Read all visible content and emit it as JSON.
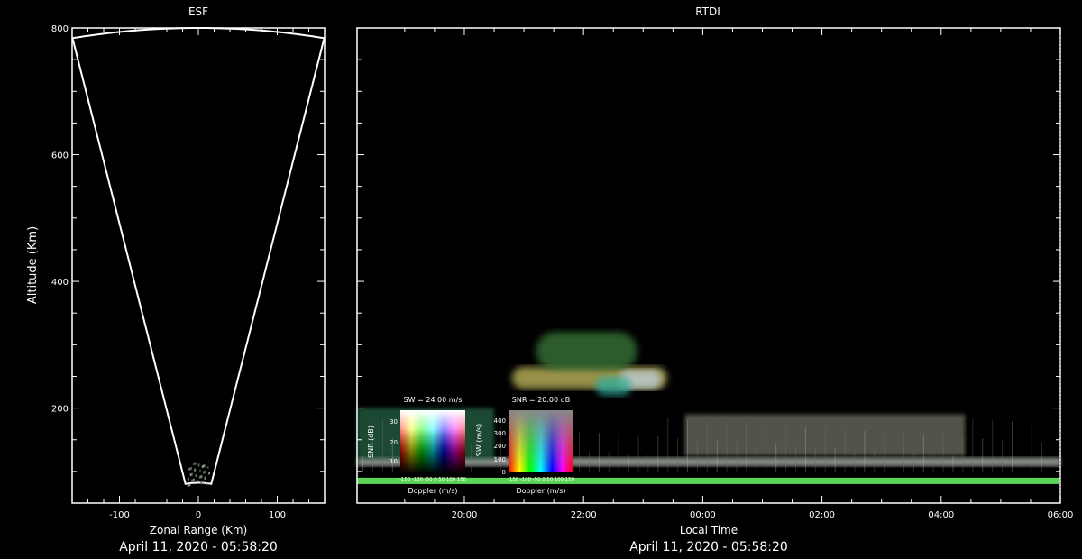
{
  "colors": {
    "background": "#000000",
    "foreground": "#ffffff",
    "echo_green": "#5fe05a"
  },
  "chart_data": [
    {
      "type": "other",
      "name": "esf-fan-plot",
      "title": "ESF",
      "xlabel": "Zonal Range (Km)",
      "ylabel": "Altitude (Km)",
      "xlim": [
        -160,
        160
      ],
      "ylim": [
        50,
        800
      ],
      "xticks": [
        -100,
        0,
        100
      ],
      "yticks": [
        200,
        400,
        600,
        800
      ],
      "minor_ytick_step": 50,
      "minor_xtick_step": 20,
      "beam_half_angle_deg": 11.5,
      "fan_min_range": 82,
      "fan_max_range": 800,
      "echo_cluster": {
        "x": 0,
        "altitude_range": [
          80,
          115
        ]
      },
      "timestamp": "April 11, 2020 - 05:58:20"
    },
    {
      "type": "heatmap",
      "name": "rtdi",
      "title": "RTDI",
      "xlabel": "Local Time",
      "ylabel": "",
      "xticks": [
        "20:00",
        "22:00",
        "00:00",
        "02:00",
        "04:00",
        "06:00"
      ],
      "x_range_hours": [
        18.2,
        30.0
      ],
      "ylim": [
        50,
        800
      ],
      "yticks": [
        200,
        400,
        600,
        800
      ],
      "minor_ytick_step": 50,
      "echo_regions": [
        {
          "desc": "continuous-low-layer",
          "t": [
            18.2,
            30.0
          ],
          "alt": [
            80,
            90
          ],
          "color": "#5fe05a"
        },
        {
          "desc": "bright-white-band",
          "t": [
            18.2,
            30.0
          ],
          "alt": [
            108,
            122
          ],
          "color": "#d8e0d8"
        },
        {
          "desc": "striated-grey-layer",
          "t": [
            23.7,
            28.4
          ],
          "alt": [
            125,
            190
          ],
          "color": "#8a8a7a"
        },
        {
          "desc": "early-green-layer",
          "t": [
            18.2,
            20.5
          ],
          "alt": [
            120,
            200
          ],
          "color": "#2f7a55"
        },
        {
          "desc": "plume-base",
          "t": [
            20.8,
            23.4
          ],
          "alt": [
            230,
            265
          ],
          "color": "#c8c060"
        },
        {
          "desc": "plume-top",
          "t": [
            21.2,
            22.9
          ],
          "alt": [
            260,
            320
          ],
          "color": "#3a7a3a"
        },
        {
          "desc": "plume-core",
          "t": [
            22.6,
            23.3
          ],
          "alt": [
            230,
            260
          ],
          "color": "#c0d0e0"
        },
        {
          "desc": "plume-cyan",
          "t": [
            22.2,
            22.8
          ],
          "alt": [
            220,
            250
          ],
          "color": "#30b0a0"
        }
      ],
      "legends": [
        {
          "name": "snr-doppler-legend",
          "caption": "SW = 24.00 m/s",
          "ylabel": "SNR (dB)",
          "yticks": [
            "10",
            "20",
            "30"
          ],
          "xlabel": "Doppler (m/s)",
          "xticks": "-150 -100 -50 0 50 100 150"
        },
        {
          "name": "sw-doppler-legend",
          "caption": "SNR = 20.00 dB",
          "ylabel": "SW (m/s)",
          "yticks": [
            "0",
            "100",
            "200",
            "300",
            "400"
          ],
          "xlabel": "Doppler (m/s)",
          "xticks": "-150 -100 -50 0 50 100 150"
        }
      ],
      "timestamp": "April 11, 2020 - 05:58:20"
    }
  ]
}
